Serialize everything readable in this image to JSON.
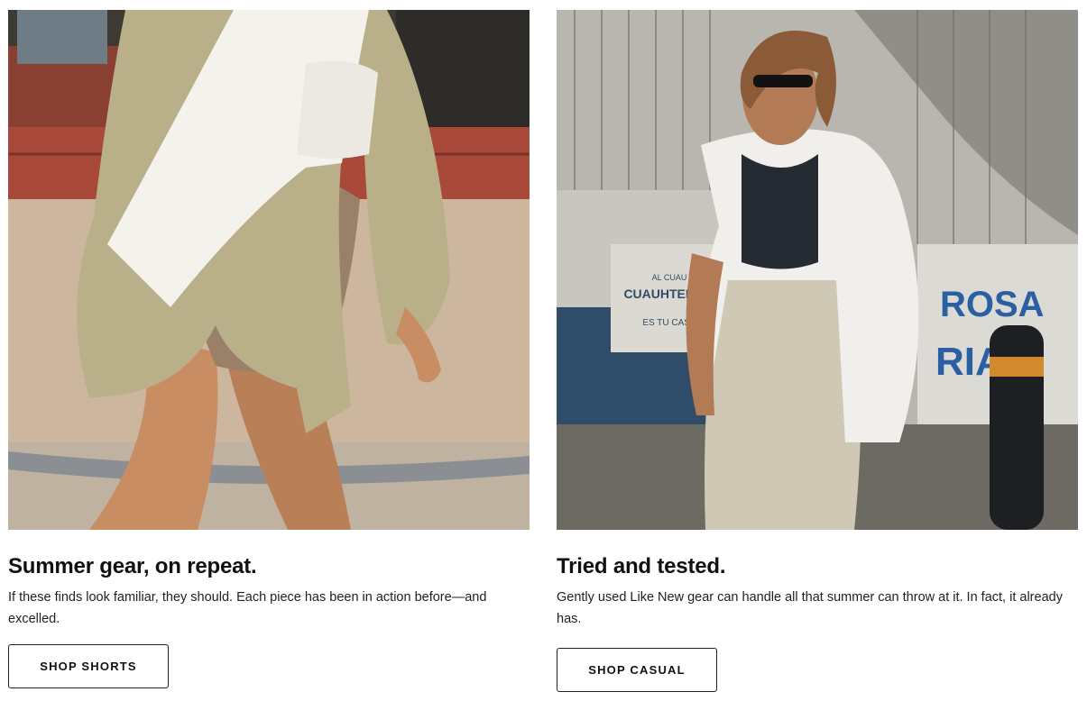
{
  "cards": [
    {
      "title": "Summer gear, on repeat.",
      "description": "If these finds look familiar, they should. Each piece has been in action before—and excelled.",
      "button_label": "SHOP SHORTS",
      "image_subject": "person-walking-in-olive-jacket-and-taupe-bike-shorts"
    },
    {
      "title": "Tried and tested.",
      "description": "Gently used Like New gear can handle all that summer can throw at it. In fact, it already has.",
      "button_label": "SHOP CASUAL",
      "image_subject": "woman-in-sunglasses-white-shirt-and-skirt",
      "signs": {
        "sign_top": "AL CUAU",
        "sign_main": "CUAUHTEMOC",
        "sign_sub": "ES TU CASA",
        "sign_right_1": "ROSA",
        "sign_right_2": "RIA"
      }
    }
  ]
}
